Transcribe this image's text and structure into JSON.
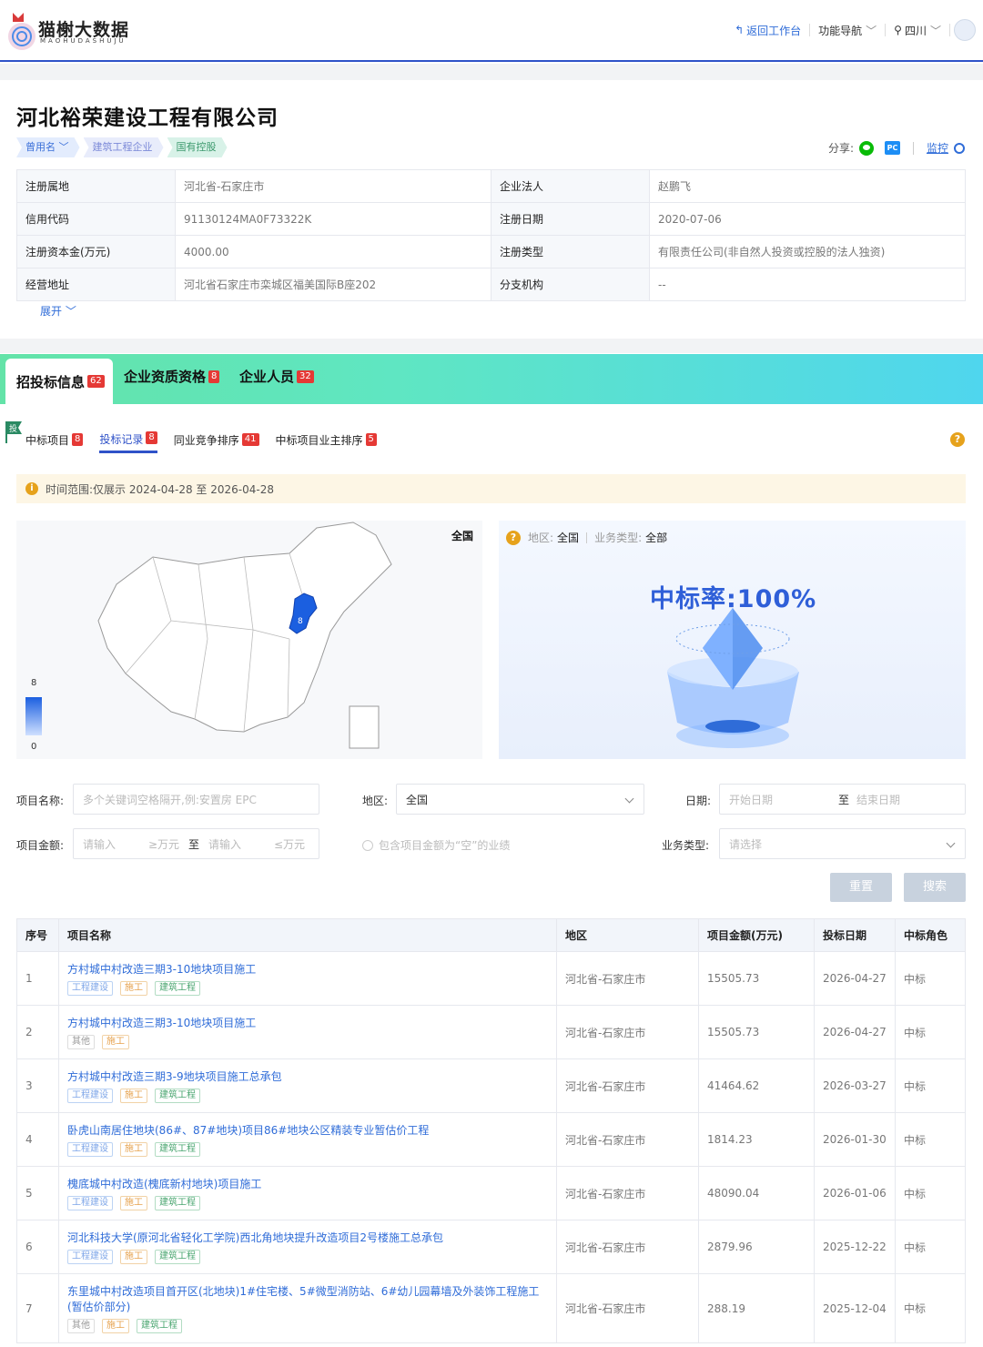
{
  "header": {
    "logo_title": "猫榭大数据",
    "logo_sub": "MAOHUDASHUJU",
    "back_label": "返回工作台",
    "nav_label": "功能导航",
    "region_label": "四川"
  },
  "company": {
    "name": "河北裕荣建设工程有限公司",
    "tags": [
      "曾用名",
      "建筑工程企业",
      "国有控股"
    ],
    "share_label": "分享:",
    "pc_label": "PC",
    "monitor_label": "监控",
    "expand_label": "展开",
    "info": [
      {
        "k1": "注册属地",
        "v1": "河北省-石家庄市",
        "k2": "企业法人",
        "v2": "赵鹏飞"
      },
      {
        "k1": "信用代码",
        "v1": "91130124MA0F73322K",
        "k2": "注册日期",
        "v2": "2020-07-06"
      },
      {
        "k1": "注册资本金(万元)",
        "v1": "4000.00",
        "k2": "注册类型",
        "v2": "有限责任公司(非自然人投资或控股的法人独资)"
      },
      {
        "k1": "经营地址",
        "v1": "河北省石家庄市栾城区福美国际B座202",
        "k2": "分支机构",
        "v2": "--"
      }
    ]
  },
  "main_tabs": [
    {
      "label": "招投标信息",
      "count": "62"
    },
    {
      "label": "企业资质资格",
      "count": "8"
    },
    {
      "label": "企业人员",
      "count": "32"
    }
  ],
  "flag_char": "投",
  "sub_tabs": [
    {
      "label": "中标项目",
      "count": "8"
    },
    {
      "label": "投标记录",
      "count": "8"
    },
    {
      "label": "同业竞争排序",
      "count": "41"
    },
    {
      "label": "中标项目业主排序",
      "count": "5"
    }
  ],
  "help_char": "?",
  "notice": "时间范围:仅展示 2024-04-28 至 2026-04-28",
  "map": {
    "label": "全国",
    "legend_max": "8",
    "legend_min": "0",
    "hebei_value": "8"
  },
  "rate_panel": {
    "region_label": "地区:",
    "region_value": "全国",
    "type_label": "业务类型:",
    "type_value": "全部",
    "rate_text": "中标率:100%"
  },
  "filters": {
    "name_label": "项目名称:",
    "name_placeholder": "多个关键词空格隔开,例:安置房 EPC",
    "region_label": "地区:",
    "region_value": "全国",
    "date_label": "日期:",
    "date_start": "开始日期",
    "date_to": "至",
    "date_end": "结束日期",
    "amount_label": "项目金额:",
    "amount_min_ph": "请输入",
    "amount_min_unit": "≥万元",
    "amount_to": "至",
    "amount_max_ph": "请输入",
    "amount_max_unit": "≤万元",
    "include_empty": "包含项目金额为“空”的业绩",
    "type_label": "业务类型:",
    "type_placeholder": "请选择",
    "reset": "重置",
    "search": "搜索"
  },
  "table": {
    "headers": [
      "序号",
      "项目名称",
      "地区",
      "项目金额(万元)",
      "投标日期",
      "中标角色"
    ],
    "rows": [
      {
        "no": "1",
        "name": "方村城中村改造三期3-10地块项目施工",
        "tags": [
          [
            "工程建设",
            "blue"
          ],
          [
            "施工",
            "orange"
          ],
          [
            "建筑工程",
            "green"
          ]
        ],
        "region": "河北省-石家庄市",
        "amount": "15505.73",
        "date": "2026-04-27",
        "role": "中标"
      },
      {
        "no": "2",
        "name": "方村城中村改造三期3-10地块项目施工",
        "tags": [
          [
            "其他",
            "gray"
          ],
          [
            "施工",
            "orange"
          ]
        ],
        "region": "河北省-石家庄市",
        "amount": "15505.73",
        "date": "2026-04-27",
        "role": "中标"
      },
      {
        "no": "3",
        "name": "方村城中村改造三期3-9地块项目施工总承包",
        "tags": [
          [
            "工程建设",
            "blue"
          ],
          [
            "施工",
            "orange"
          ],
          [
            "建筑工程",
            "green"
          ]
        ],
        "region": "河北省-石家庄市",
        "amount": "41464.62",
        "date": "2026-03-27",
        "role": "中标"
      },
      {
        "no": "4",
        "name": "卧虎山南居住地块(86#、87#地块)项目86#地块公区精装专业暂估价工程",
        "tags": [
          [
            "工程建设",
            "blue"
          ],
          [
            "施工",
            "orange"
          ],
          [
            "建筑工程",
            "green"
          ]
        ],
        "region": "河北省-石家庄市",
        "amount": "1814.23",
        "date": "2026-01-30",
        "role": "中标"
      },
      {
        "no": "5",
        "name": "槐底城中村改造(槐底新村地块)项目施工",
        "tags": [
          [
            "工程建设",
            "blue"
          ],
          [
            "施工",
            "orange"
          ],
          [
            "建筑工程",
            "green"
          ]
        ],
        "region": "河北省-石家庄市",
        "amount": "48090.04",
        "date": "2026-01-06",
        "role": "中标"
      },
      {
        "no": "6",
        "name": "河北科技大学(原河北省轻化工学院)西北角地块提升改造项目2号楼施工总承包",
        "tags": [
          [
            "工程建设",
            "blue"
          ],
          [
            "施工",
            "orange"
          ],
          [
            "建筑工程",
            "green"
          ]
        ],
        "region": "河北省-石家庄市",
        "amount": "2879.96",
        "date": "2025-12-22",
        "role": "中标"
      },
      {
        "no": "7",
        "name": "东里城中村改造项目首开区(北地块)1#住宅楼、5#微型消防站、6#幼儿园幕墙及外装饰工程施工(暂估价部分)",
        "tags": [
          [
            "其他",
            "gray"
          ],
          [
            "施工",
            "orange"
          ],
          [
            "建筑工程",
            "green"
          ]
        ],
        "region": "河北省-石家庄市",
        "amount": "288.19",
        "date": "2025-12-04",
        "role": "中标"
      }
    ]
  },
  "colors": {
    "accent": "#2f52c8",
    "link": "#2f6cd8",
    "win": "#e53935",
    "rate": "#2f5fd8"
  }
}
